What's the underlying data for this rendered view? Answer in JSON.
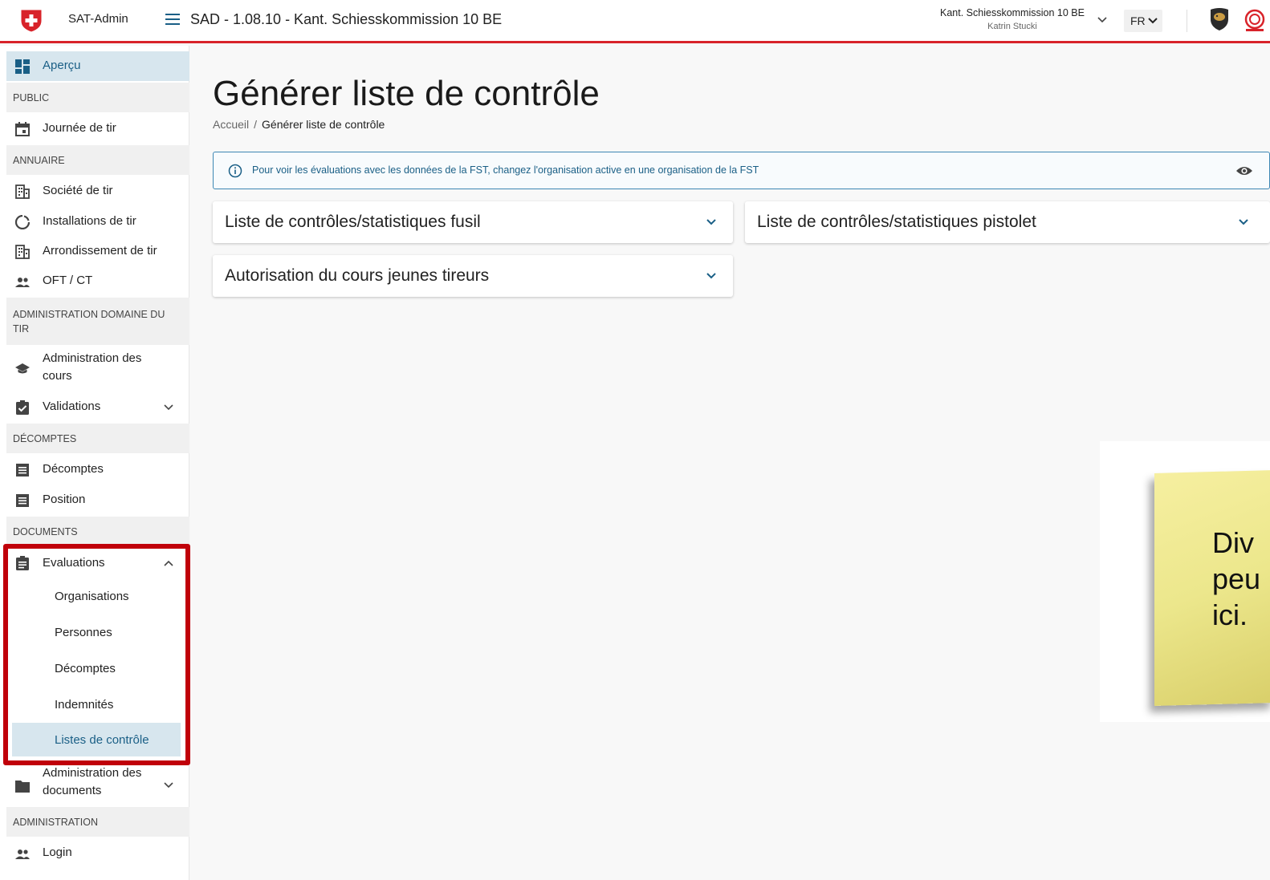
{
  "header": {
    "app_name": "SAT-Admin",
    "title": "SAD - 1.08.10 - Kant. Schiesskommission 10 BE",
    "organization": "Kant. Schiesskommission 10 BE",
    "user": "Katrin Stucki",
    "language": "FR",
    "brand_color": "#d8232a"
  },
  "sidebar": {
    "overview": "Aperçu",
    "sections": {
      "public": "PUBLIC",
      "directory": "ANNUAIRE",
      "admin_domain": "ADMINISTRATION DOMAINE DU TIR",
      "billing": "DÉCOMPTES",
      "documents": "DOCUMENTS",
      "administration": "ADMINISTRATION"
    },
    "items": {
      "shooting_day": "Journée de tir",
      "shooting_club": "Société de tir",
      "shooting_installations": "Installations de tir",
      "shooting_district": "Arrondissement de tir",
      "oft_ct": "OFT / CT",
      "course_admin": "Administration des cours",
      "validations": "Validations",
      "billings": "Décomptes",
      "position": "Position",
      "evaluations": "Evaluations",
      "doc_admin": "Administration des documents",
      "login": "Login"
    },
    "evaluations_sub": {
      "organisations": "Organisations",
      "persons": "Personnes",
      "billings": "Décomptes",
      "allowances": "Indemnités",
      "checklists": "Listes de contrôle"
    },
    "active_color": "#1a5f86",
    "highlight_color": "#c0000a"
  },
  "main": {
    "page_title": "Générer liste de contrôle",
    "breadcrumb": {
      "home": "Accueil",
      "separator": "/",
      "current": "Générer liste de contrôle"
    },
    "info_message": "Pour voir les évaluations avec les données de la FST, changez l'organisation active en une organisation de la FST",
    "panels": {
      "rifle": "Liste de contrôles/statistiques fusil",
      "pistol": "Liste de contrôles/statistiques pistolet",
      "youth_course": "Autorisation du cours jeunes tireurs"
    }
  },
  "sticky_note": {
    "line1": "Div",
    "line2": "peu",
    "line3": "ici."
  }
}
